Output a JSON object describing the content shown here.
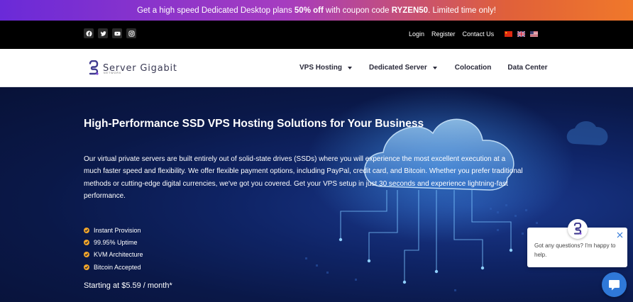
{
  "promo": {
    "prefix": "Get a high speed Dedicated Desktop plans ",
    "discount": "50% off",
    "middle": " with coupon code ",
    "code": "RYZEN50",
    "suffix": ". Limited time only!"
  },
  "topbar": {
    "social_icons": [
      "facebook-icon",
      "twitter-icon",
      "youtube-icon",
      "instagram-icon"
    ],
    "links": {
      "login": "Login",
      "register": "Register",
      "contact": "Contact Us"
    },
    "flags": [
      "china-flag",
      "uk-flag",
      "us-flag"
    ]
  },
  "logo": {
    "name": "Server Gigabit",
    "tagline": "NETWORK"
  },
  "nav": {
    "items": [
      {
        "label": "VPS Hosting",
        "dropdown": true
      },
      {
        "label": "Dedicated Server",
        "dropdown": true
      },
      {
        "label": "Colocation",
        "dropdown": false
      },
      {
        "label": "Data Center",
        "dropdown": false
      }
    ]
  },
  "hero": {
    "title": "High-Performance SSD VPS Hosting Solutions for Your Business",
    "intro": "Our virtual private servers are built entirely out of solid-state drives (SSDs) where you will experience the most excellent execution at a much faster speed and flexibility. We offer flexible payment options, including PayPal, credit card, and Bitcoin. Whether you prefer traditional methods or cutting-edge digital currencies, we've got you covered. Get your VPS setup in just 30 seconds and experience lightning-fast performance.",
    "features": [
      "Instant Provision",
      "99.95% Uptime",
      "KVM Architecture",
      "Bitcoin Accepted"
    ],
    "price": "Starting at $5.59 / month*"
  },
  "chat": {
    "message": "Got any questions? I'm happy to help."
  },
  "colors": {
    "accent": "#f2a62a",
    "chat_blue": "#2f78d8",
    "brand_purple": "#3f3a8f"
  }
}
